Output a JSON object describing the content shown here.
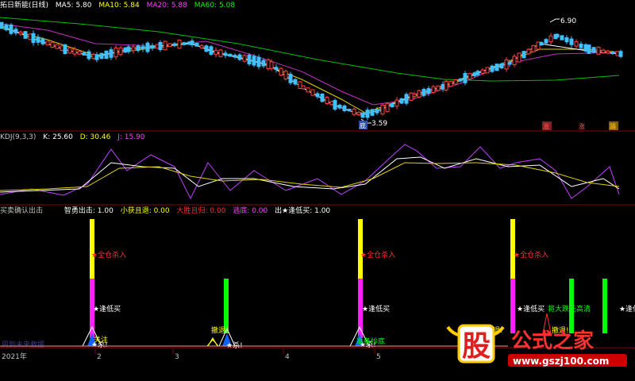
{
  "main": {
    "title": "拓日新能(日线)",
    "ma_labels": [
      {
        "name": "MA5: 5.80",
        "color": "#ffffff"
      },
      {
        "name": "MA10: 5.84",
        "color": "#ffff00"
      },
      {
        "name": "MA20: 5.88",
        "color": "#ff40ff"
      },
      {
        "name": "MA60: 5.08",
        "color": "#00ff00"
      }
    ],
    "high_label": "6.90",
    "low_label": "3.59",
    "markers": [
      "涨",
      "涨",
      "踊"
    ],
    "low_marker": "底"
  },
  "kdj": {
    "title": "KDJ(9,3,3)",
    "k": "K: 25.60",
    "d": "D: 30.46",
    "j": "J: 15.90"
  },
  "signals": {
    "title": "买卖确认出击",
    "labels": [
      {
        "text": "智勇出击: 1.00",
        "color": "#ffffff"
      },
      {
        "text": "小获且退: 0.00",
        "color": "#ffff00"
      },
      {
        "text": "大胜且归: 0.00",
        "color": "#ff3030"
      },
      {
        "text": "逃底: 0.00",
        "color": "#ff40ff"
      },
      {
        "text": "出★逢低买: 1.00",
        "color": "#ffffff"
      }
    ],
    "annotations": {
      "full_buy": "★全仓杀入",
      "low_buy": "★逢低买",
      "watch": "关注",
      "retreat": "撤退!",
      "dive": "★杀!",
      "bottom_fish": "准备抄底",
      "big_drop": "将大跌先高清",
      "low_buy_cut": "★逢低"
    },
    "bottom_text": "周到未来救援"
  },
  "xaxis": {
    "ticks": [
      "2021年",
      "2",
      "3",
      "4",
      "5"
    ]
  },
  "watermark": {
    "logo": "股",
    "title": "公式之家",
    "url": "www.gszj100.com"
  }
}
